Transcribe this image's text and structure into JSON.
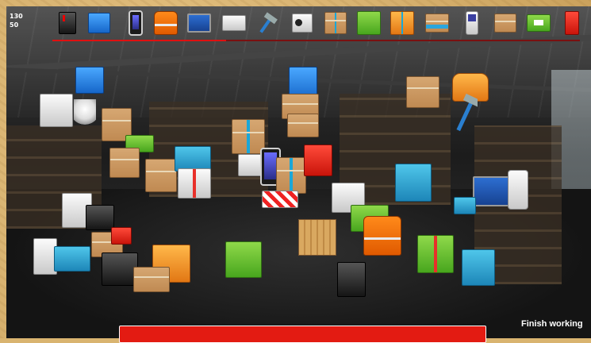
{
  "score": {
    "line1": "130",
    "line2": "50"
  },
  "toolbar": {
    "progress_fraction": 0.33,
    "items": [
      {
        "icon": "black-box-icon"
      },
      {
        "icon": "blue-box-pallet-icon"
      },
      {
        "icon": "smartphone-icon"
      },
      {
        "icon": "life-vest-icon"
      },
      {
        "icon": "laptop-icon"
      },
      {
        "icon": "printer-icon"
      },
      {
        "icon": "hammer-icon"
      },
      {
        "icon": "camcorder-icon"
      },
      {
        "icon": "cyan-gift-icon"
      },
      {
        "icon": "green-box-icon"
      },
      {
        "icon": "cyan-gift-orange-icon"
      },
      {
        "icon": "crate-icon"
      },
      {
        "icon": "phone-keypad-icon"
      },
      {
        "icon": "cardboard-box-icon"
      },
      {
        "icon": "green-box-2-icon"
      },
      {
        "icon": "red-box-icon"
      }
    ]
  },
  "finish_label": "Finish working",
  "colors": {
    "accent_red": "#e31b12",
    "frame": "#d9b470"
  }
}
